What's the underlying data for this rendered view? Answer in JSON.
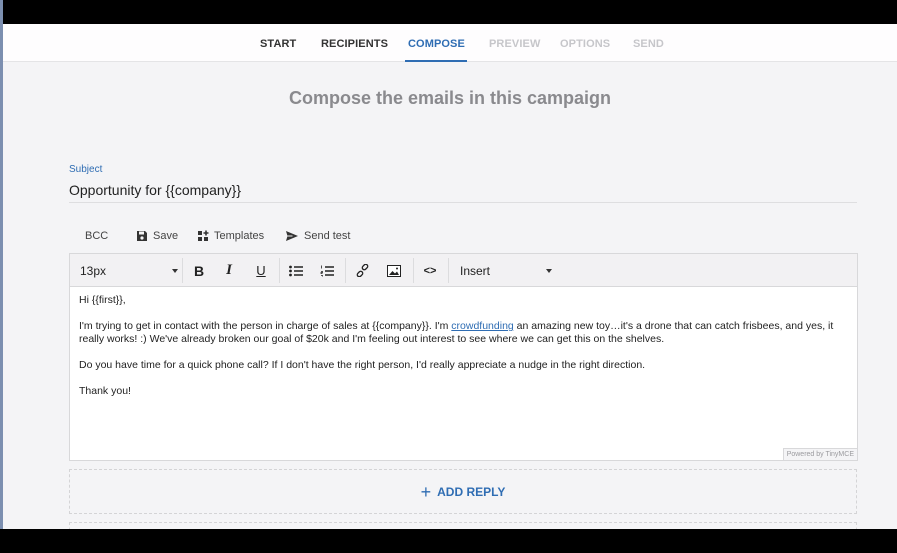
{
  "stepper": {
    "steps": [
      {
        "label": "START",
        "state": "done"
      },
      {
        "label": "RECIPIENTS",
        "state": "done"
      },
      {
        "label": "COMPOSE",
        "state": "active"
      },
      {
        "label": "PREVIEW",
        "state": "disabled"
      },
      {
        "label": "OPTIONS",
        "state": "disabled"
      },
      {
        "label": "SEND",
        "state": "disabled"
      }
    ]
  },
  "page": {
    "heading": "Compose the emails in this campaign"
  },
  "subject": {
    "label": "Subject",
    "value": "Opportunity for {{company}}"
  },
  "actions": {
    "bcc": "BCC",
    "save": "Save",
    "templates": "Templates",
    "send_test": "Send test"
  },
  "toolbar": {
    "font_size": "13px",
    "insert": "Insert",
    "icons": [
      "bold-icon",
      "italic-icon",
      "underline-icon",
      "bullet-list-icon",
      "numbered-list-icon",
      "link-icon",
      "image-icon",
      "source-code-icon"
    ]
  },
  "email_body": {
    "greeting": "Hi {{first}},",
    "p1_before_link": "I'm trying to get in contact with the person in charge of sales at {{company}}. I'm ",
    "p1_link": "crowdfunding",
    "p1_after_link": " an amazing new toy…it's a drone that can catch frisbees, and yes, it really works! :) We've already broken our goal of $20k and I'm feeling out interest to see where we can get this on the shelves.",
    "p2": "Do you have time for a quick phone call? If I don't have the right person, I'd really appreciate a nudge in the right direction.",
    "p3": "Thank you!"
  },
  "editor_footer": {
    "powered_by": "Powered by TinyMCE"
  },
  "add_reply": {
    "label": "ADD REPLY"
  },
  "colors": {
    "accent": "#2f6db3",
    "background": "#f4f4f6",
    "disabled_step": "#c6c6ca"
  }
}
